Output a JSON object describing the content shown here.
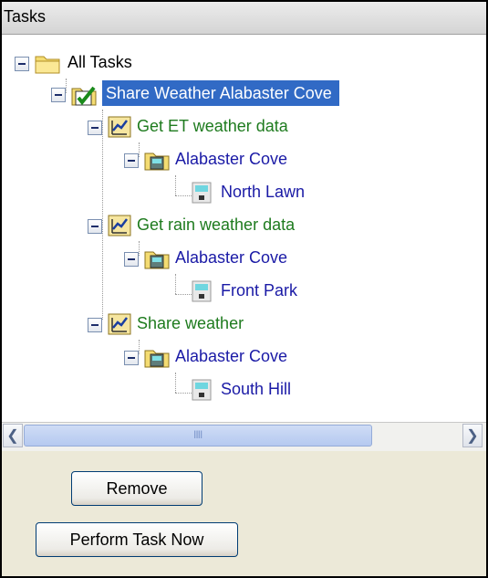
{
  "panel": {
    "title": "Tasks"
  },
  "tree": {
    "root": "All Tasks",
    "task": "Share Weather Alabaster Cove",
    "subtasks": [
      {
        "label": "Get ET weather data",
        "site": "Alabaster Cove",
        "station": "North Lawn"
      },
      {
        "label": "Get rain weather data",
        "site": "Alabaster Cove",
        "station": "Front Park"
      },
      {
        "label": "Share weather",
        "site": "Alabaster Cove",
        "station": "South Hill"
      }
    ]
  },
  "scrollbar": {
    "grip": "IIII"
  },
  "buttons": {
    "remove": "Remove",
    "perform": "Perform Task Now"
  },
  "colors": {
    "selection": "#316ac5",
    "subtask_text": "#1e7b1e",
    "node_text": "#1a1aa6"
  }
}
